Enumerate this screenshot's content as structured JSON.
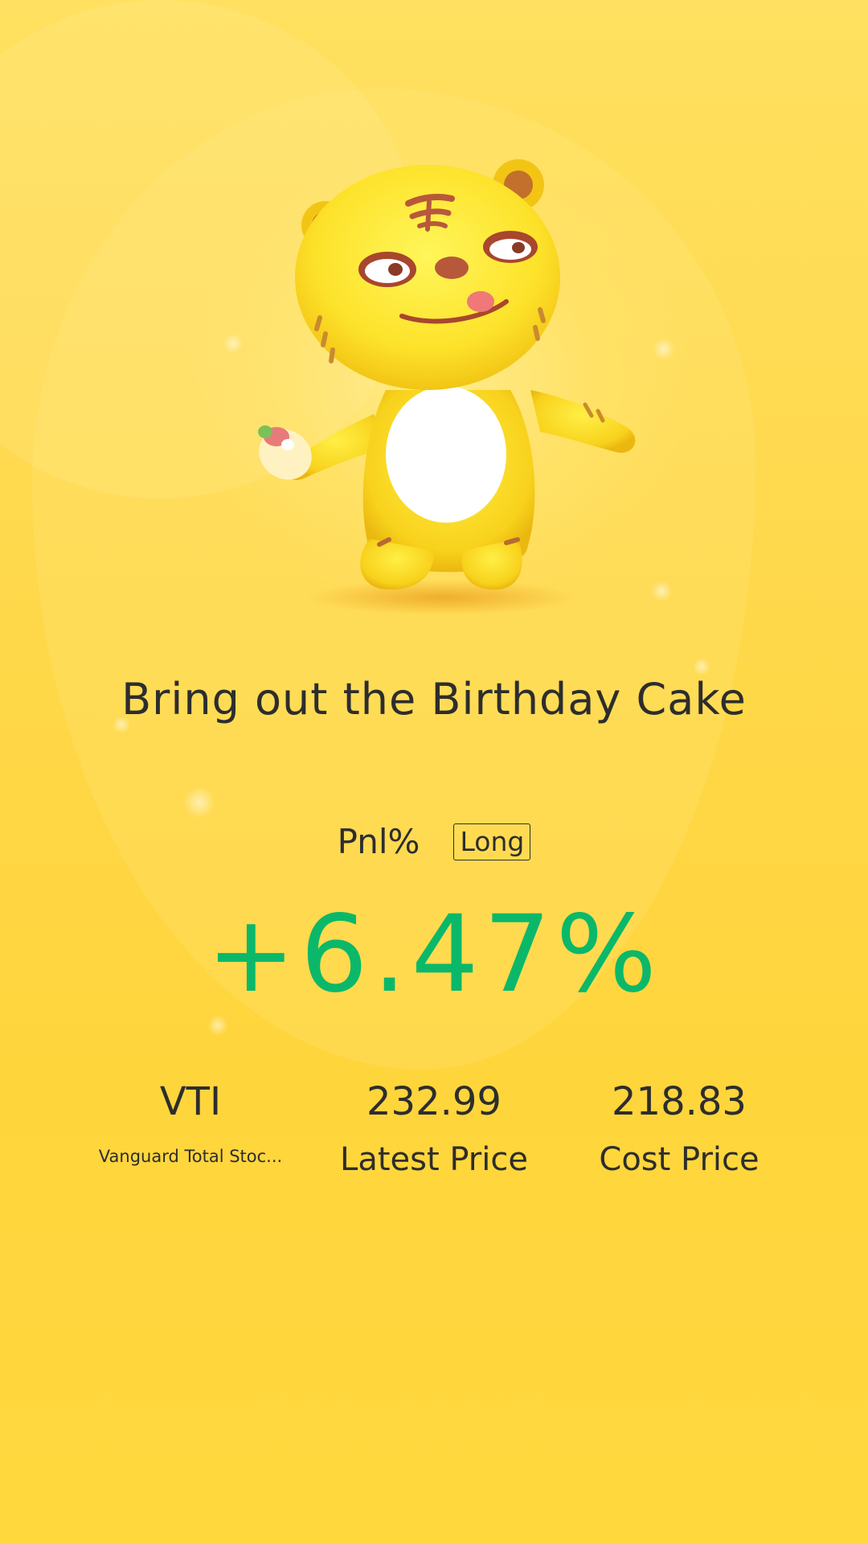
{
  "headline": "Bring out the Birthday Cake",
  "pnl": {
    "label": "Pnl%",
    "position_badge": "Long",
    "value": "+6.47%",
    "value_color": "#0bb86a"
  },
  "stock": {
    "ticker": "VTI",
    "name": "Vanguard Total Stoc..."
  },
  "latest_price": {
    "value": "232.99",
    "label": "Latest Price"
  },
  "cost_price": {
    "value": "218.83",
    "label": "Cost Price"
  },
  "mascot": {
    "icon": "tiger-mascot-icon"
  },
  "colors": {
    "background": "#ffd73a",
    "text": "#2d2d2d",
    "gain": "#0bb86a"
  }
}
